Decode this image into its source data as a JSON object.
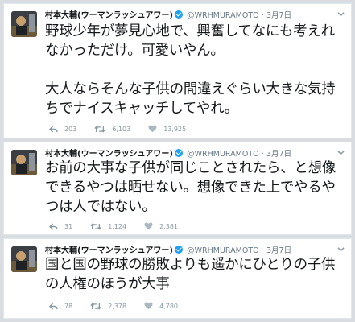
{
  "tweets": [
    {
      "name": "村本大輔(ウーマンラッシュアワー)",
      "handle": "@WRHMURAMOTO",
      "dot": "·",
      "date": "3月7日",
      "text": "野球少年が夢見心地で、興奮してなにも考えれなかっただけ。可愛いやん。\n\n大人ならそんな子供の間違えぐらい大きな気持ちでナイスキャッチしてやれ。",
      "replies": "203",
      "retweets": "6,103",
      "likes": "13,925"
    },
    {
      "name": "村本大輔(ウーマンラッシュアワー)",
      "handle": "@WRHMURAMOTO",
      "dot": "·",
      "date": "3月7日",
      "text": "お前の大事な子供が同じことされたら、と想像できるやつは晒せない。想像できた上でやるやつは人ではない。",
      "replies": "31",
      "retweets": "1,124",
      "likes": "2,381"
    },
    {
      "name": "村本大輔(ウーマンラッシュアワー)",
      "handle": "@WRHMURAMOTO",
      "dot": "·",
      "date": "3月7日",
      "text": "国と国の野球の勝敗よりも遥かにひとりの子供の人権のほうが大事",
      "replies": "78",
      "retweets": "2,378",
      "likes": "4,780"
    }
  ],
  "icons": {
    "reply": "reply-icon",
    "retweet": "retweet-icon",
    "like": "heart-icon",
    "verified": "verified-badge-icon",
    "menu": "chevron-down-icon"
  },
  "colors": {
    "verified": "#1da1f2",
    "meta": "#8899a6",
    "text": "#14171a"
  }
}
